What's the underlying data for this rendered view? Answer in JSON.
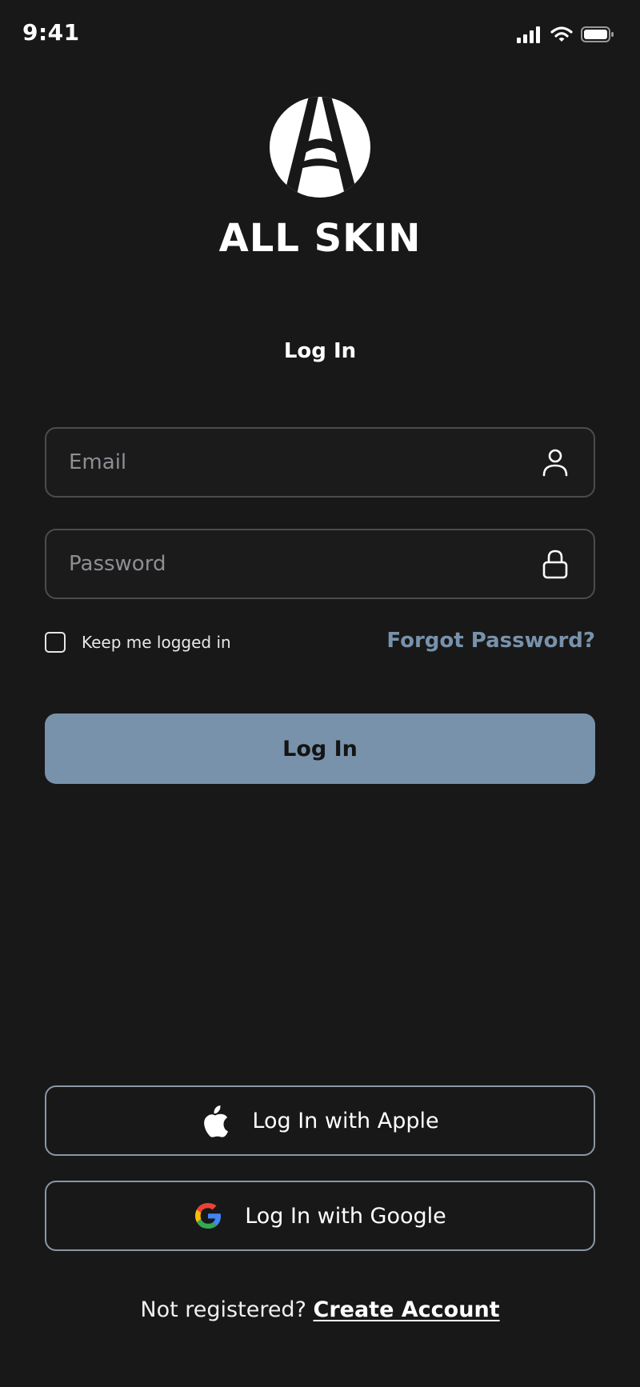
{
  "status_bar": {
    "time": "9:41",
    "icons": [
      "signal-icon",
      "wifi-icon",
      "battery-icon"
    ]
  },
  "brand": {
    "name": "ALL SKIN",
    "logo_icon": "all-skin-logo"
  },
  "screen_title": "Log In",
  "form": {
    "email_placeholder": "Email",
    "email_value": "",
    "email_icon": "user-icon",
    "password_placeholder": "Password",
    "password_value": "",
    "password_icon": "lock-icon",
    "keep_logged_in_label": "Keep me logged in",
    "keep_logged_in_checked": false,
    "forgot_password": "Forgot Password?",
    "submit_label": "Log In"
  },
  "social": {
    "apple_label": "Log In with Apple",
    "google_label": "Log In with Google"
  },
  "footer": {
    "prompt": "Not registered?",
    "create_account": "Create Account"
  },
  "colors": {
    "background": "#181818",
    "accent": "#7892ab",
    "field_border": "#4a4c50",
    "social_border": "#8a97a6",
    "google_blue": "#4285F4",
    "google_red": "#EA4335",
    "google_yellow": "#FBBC05",
    "google_green": "#34A853"
  }
}
